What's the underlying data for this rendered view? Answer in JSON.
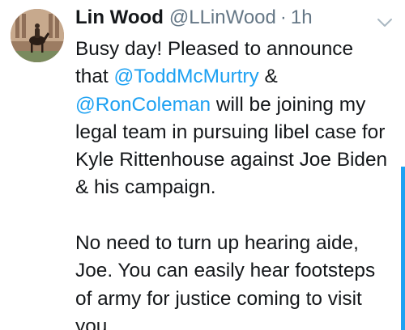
{
  "tweet": {
    "display_name": "Lin Wood",
    "handle": "@LLinWood",
    "separator": "·",
    "time": "1h",
    "lines": {
      "l1": "Busy day! Pleased to announce",
      "l2_pre": "that ",
      "l2_mention": "@ToddMcMurtry",
      "l2_post": " &",
      "l3_mention": "@RonColeman",
      "l3_post": " will be joining my",
      "l4": "legal team in pursuing libel case for",
      "l5": "Kyle Rittenhouse against Joe Biden",
      "l6": "& his campaign.",
      "l8": "No need to turn up hearing aide,",
      "l9": "Joe. You can easily hear footsteps",
      "l10": "of army for justice coming to visit",
      "l11": "you."
    }
  },
  "colors": {
    "text": "#14171a",
    "secondary": "#657786",
    "accent": "#1da1f2"
  },
  "icons": {
    "avatar": "profile-photo-horse-rider",
    "caret": "chevron-down-icon"
  }
}
